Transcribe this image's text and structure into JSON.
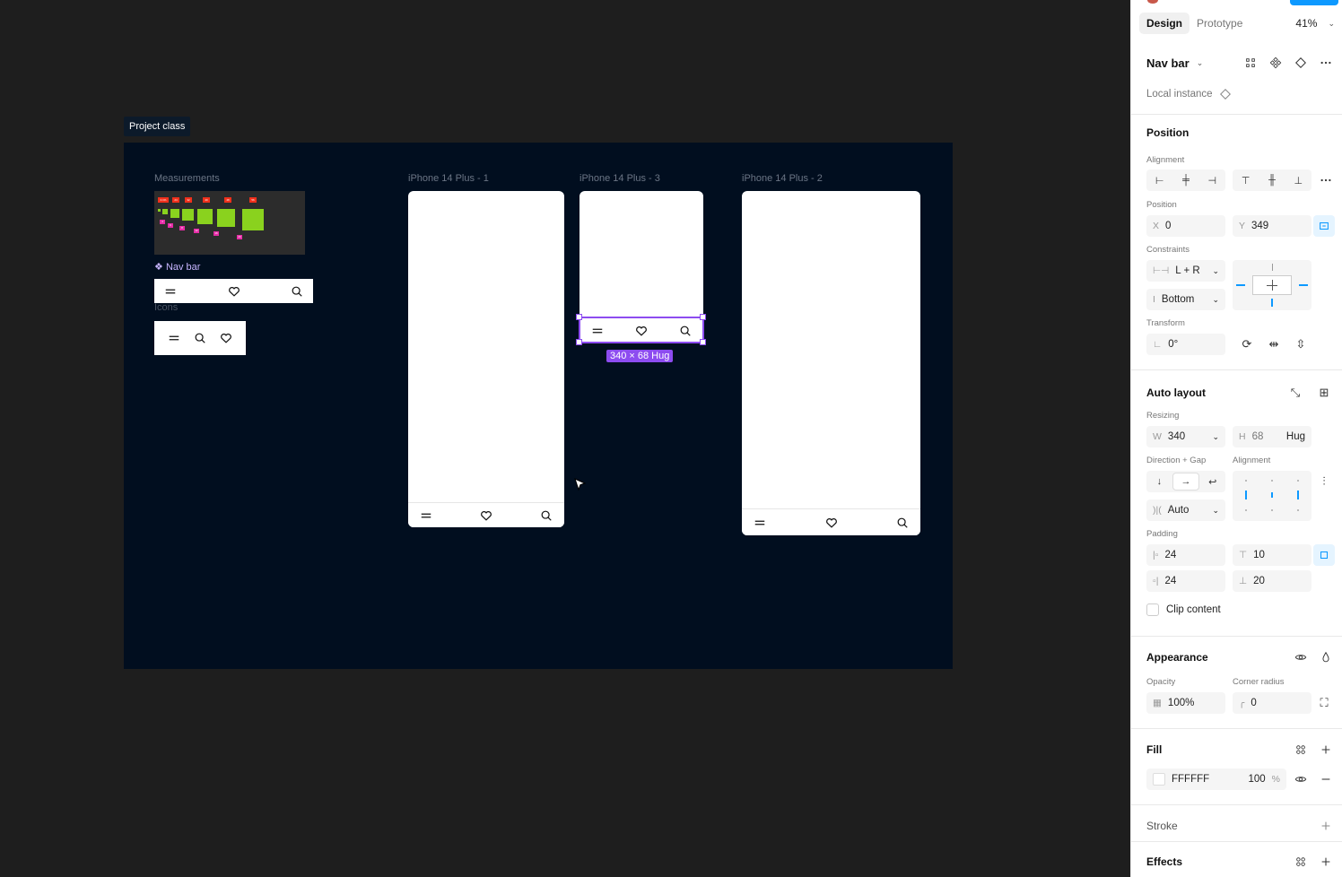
{
  "canvas": {
    "section_title": "Project class",
    "measurements_label": "Measurements",
    "measurement_tags": [
      "0.1%",
      "24",
      "32",
      "40",
      "48",
      "56",
      "4",
      "6",
      "8",
      "12",
      "16",
      "20"
    ],
    "component_label": "Nav bar",
    "icons_label": "Icons",
    "frames": [
      {
        "label": "iPhone 14 Plus - 1"
      },
      {
        "label": "iPhone 14 Plus - 3"
      },
      {
        "label": "iPhone 14 Plus - 2"
      }
    ],
    "selection_badge": "340 × 68 Hug"
  },
  "panel": {
    "tabs": {
      "design": "Design",
      "prototype": "Prototype"
    },
    "zoom": "41%",
    "layer_name": "Nav bar",
    "instance_label": "Local instance",
    "position": {
      "title": "Position",
      "alignment_label": "Alignment",
      "position_label": "Position",
      "x_key": "X",
      "x_value": "0",
      "y_key": "Y",
      "y_value": "349",
      "constraints_label": "Constraints",
      "constraint_h": "L + R",
      "constraint_v": "Bottom",
      "transform_label": "Transform",
      "rotation": "0°"
    },
    "auto_layout": {
      "title": "Auto layout",
      "resizing_label": "Resizing",
      "w_key": "W",
      "w_value": "340",
      "h_key": "H",
      "h_value": "68",
      "h_mode": "Hug",
      "direction_label": "Direction + Gap",
      "alignment_label": "Alignment",
      "gap_value": "Auto",
      "padding_label": "Padding",
      "pad_left": "24",
      "pad_top": "10",
      "pad_right": "24",
      "pad_bottom": "20",
      "clip_label": "Clip content"
    },
    "appearance": {
      "title": "Appearance",
      "opacity_label": "Opacity",
      "opacity_value": "100%",
      "radius_label": "Corner radius",
      "radius_value": "0"
    },
    "fill": {
      "title": "Fill",
      "hex": "FFFFFF",
      "opacity": "100",
      "unit": "%"
    },
    "stroke": {
      "title": "Stroke"
    },
    "effects": {
      "title": "Effects"
    }
  },
  "colors": {
    "selection": "#8d4cf0",
    "accent": "#0d99ff",
    "canvas_bg": "#1e1e1e",
    "section_bg": "#010e1f"
  }
}
